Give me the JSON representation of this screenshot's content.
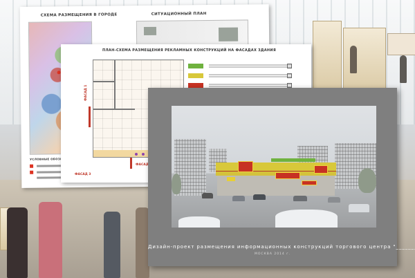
{
  "sheet_city": {
    "left_title": "СХЕМА РАЗМЕЩЕНИЯ В ГОРОДЕ",
    "right_title": "СИТУАЦИОННЫЙ ПЛАН",
    "legend_title": "УСЛОВНЫЕ ОБОЗНАЧЕНИЯ"
  },
  "sheet_facade": {
    "title": "ПЛАН-СХЕМА РАЗМЕЩЕНИЯ РЕКЛАМНЫХ КОНСТРУКЦИЙ НА ФАСАДАХ ЗДАНИЯ",
    "label_facade_1": "ФАСАД 1",
    "label_facade_2": "ФАСАД 2",
    "label_facade_3": "ФАСАД 3"
  },
  "main_slide": {
    "caption": "Дизайн-проект размещения информационных конструкций торгового центра \"__________\"",
    "subcaption": "МОСКВА 2014 г."
  },
  "colors": {
    "slide_frame": "#7f7f7f",
    "sign_red": "#c73223",
    "sign_yellow": "#d8c83a",
    "facade_label": "#c0392b"
  }
}
